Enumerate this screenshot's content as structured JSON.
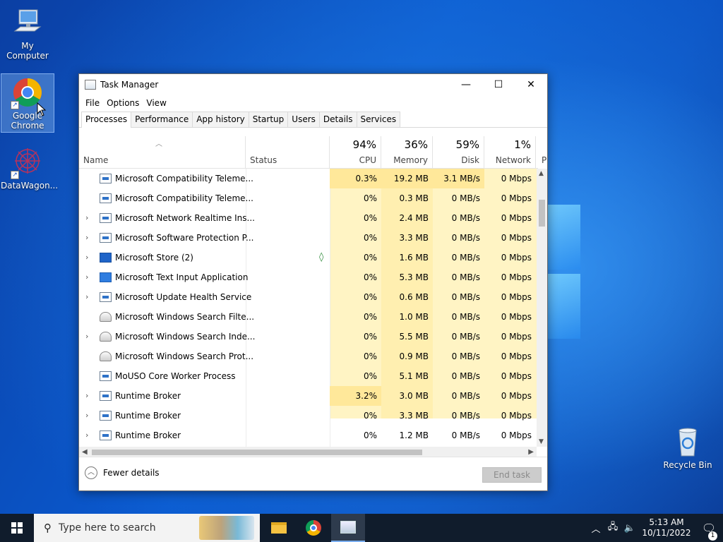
{
  "desktop": {
    "icons": [
      {
        "label": "My Computer"
      },
      {
        "label": "Google Chrome"
      },
      {
        "label": "DataWagon..."
      },
      {
        "label": "Recycle Bin"
      }
    ]
  },
  "window": {
    "title": "Task Manager",
    "menu": [
      "File",
      "Options",
      "View"
    ],
    "tabs": [
      "Processes",
      "Performance",
      "App history",
      "Startup",
      "Users",
      "Details",
      "Services"
    ],
    "active_tab": "Processes",
    "columns": {
      "name": "Name",
      "status": "Status",
      "cpu": {
        "label": "CPU",
        "pct": "94%"
      },
      "memory": {
        "label": "Memory",
        "pct": "36%"
      },
      "disk": {
        "label": "Disk",
        "pct": "59%"
      },
      "network": {
        "label": "Network",
        "pct": "1%"
      },
      "partial": "P"
    },
    "rows": [
      {
        "name": "Microsoft Compatibility Teleme...",
        "expand": false,
        "icon": "generic",
        "status": "",
        "cpu": "0.3%",
        "mem": "19.2 MB",
        "disk": "3.1 MB/s",
        "net": "0 Mbps"
      },
      {
        "name": "Microsoft Compatibility Teleme...",
        "expand": false,
        "icon": "generic",
        "status": "",
        "cpu": "0%",
        "mem": "0.3 MB",
        "disk": "0 MB/s",
        "net": "0 Mbps"
      },
      {
        "name": "Microsoft Network Realtime Ins...",
        "expand": true,
        "icon": "generic",
        "status": "",
        "cpu": "0%",
        "mem": "2.4 MB",
        "disk": "0 MB/s",
        "net": "0 Mbps"
      },
      {
        "name": "Microsoft Software Protection P...",
        "expand": true,
        "icon": "generic",
        "status": "",
        "cpu": "0%",
        "mem": "3.3 MB",
        "disk": "0 MB/s",
        "net": "0 Mbps"
      },
      {
        "name": "Microsoft Store (2)",
        "expand": true,
        "icon": "store",
        "status": "leaf",
        "cpu": "0%",
        "mem": "1.6 MB",
        "disk": "0 MB/s",
        "net": "0 Mbps"
      },
      {
        "name": "Microsoft Text Input Application",
        "expand": true,
        "icon": "text",
        "status": "",
        "cpu": "0%",
        "mem": "5.3 MB",
        "disk": "0 MB/s",
        "net": "0 Mbps"
      },
      {
        "name": "Microsoft Update Health Service",
        "expand": true,
        "icon": "generic",
        "status": "",
        "cpu": "0%",
        "mem": "0.6 MB",
        "disk": "0 MB/s",
        "net": "0 Mbps"
      },
      {
        "name": "Microsoft Windows Search Filte...",
        "expand": false,
        "icon": "user",
        "status": "",
        "cpu": "0%",
        "mem": "1.0 MB",
        "disk": "0 MB/s",
        "net": "0 Mbps"
      },
      {
        "name": "Microsoft Windows Search Inde...",
        "expand": true,
        "icon": "user",
        "status": "",
        "cpu": "0%",
        "mem": "5.5 MB",
        "disk": "0 MB/s",
        "net": "0 Mbps"
      },
      {
        "name": "Microsoft Windows Search Prot...",
        "expand": false,
        "icon": "user",
        "status": "",
        "cpu": "0%",
        "mem": "0.9 MB",
        "disk": "0 MB/s",
        "net": "0 Mbps"
      },
      {
        "name": "MoUSO Core Worker Process",
        "expand": false,
        "icon": "generic",
        "status": "",
        "cpu": "0%",
        "mem": "5.1 MB",
        "disk": "0 MB/s",
        "net": "0 Mbps"
      },
      {
        "name": "Runtime Broker",
        "expand": true,
        "icon": "generic",
        "status": "",
        "cpu": "3.2%",
        "mem": "3.0 MB",
        "disk": "0 MB/s",
        "net": "0 Mbps"
      },
      {
        "name": "Runtime Broker",
        "expand": true,
        "icon": "generic",
        "status": "",
        "cpu": "0%",
        "mem": "3.3 MB",
        "disk": "0 MB/s",
        "net": "0 Mbps"
      },
      {
        "name": "Runtime Broker",
        "expand": true,
        "icon": "generic",
        "status": "",
        "cpu": "0%",
        "mem": "1.2 MB",
        "disk": "0 MB/s",
        "net": "0 Mbps"
      }
    ],
    "footer": {
      "fewer_details": "Fewer details",
      "end_task": "End task"
    }
  },
  "taskbar": {
    "search_placeholder": "Type here to search",
    "time": "5:13 AM",
    "date": "10/11/2022",
    "notification_count": "1"
  },
  "colors": {
    "heat_light": "#fff4c4",
    "heat_medium": "#ffe89a",
    "taskbar": "#101c2c"
  }
}
